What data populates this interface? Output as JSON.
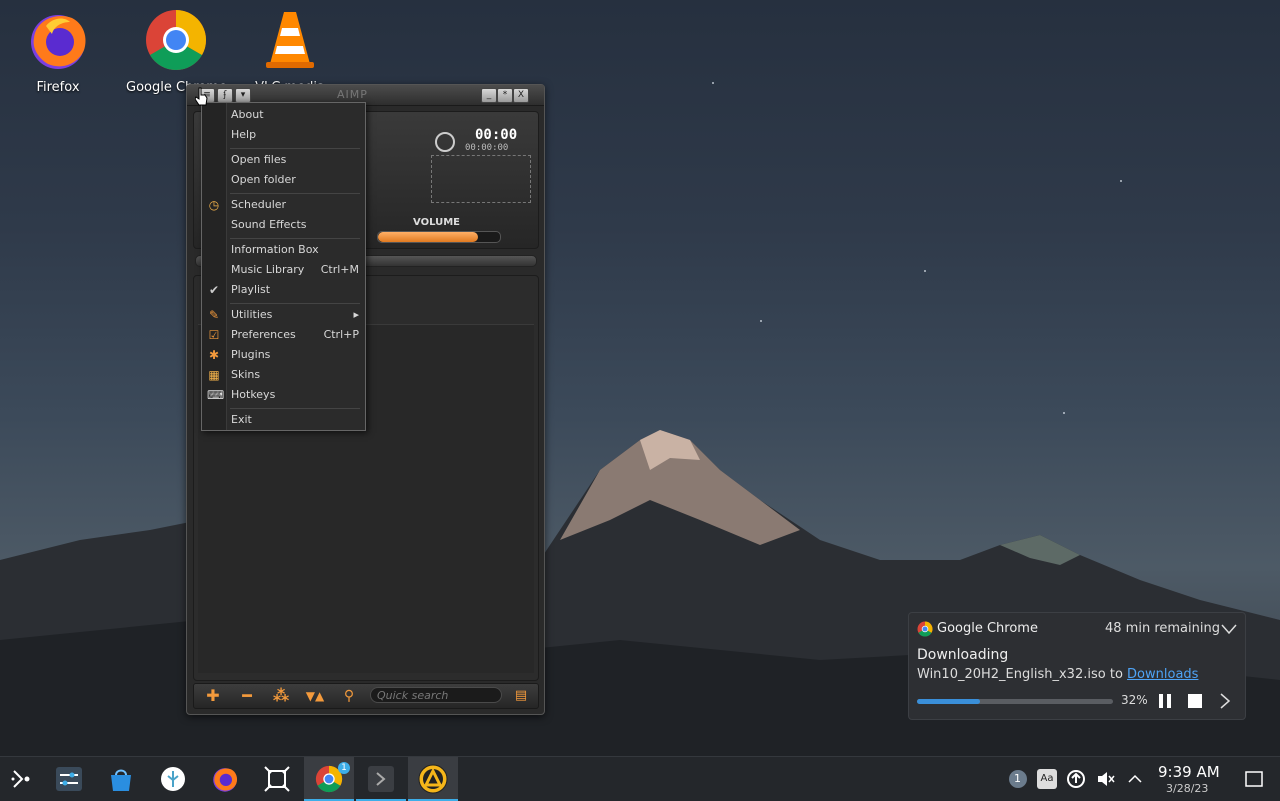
{
  "desktop_icons": [
    {
      "label": "Firefox",
      "icon": "firefox-icon"
    },
    {
      "label": "Google Chrome",
      "icon": "chrome-icon"
    },
    {
      "label": "VLC media",
      "icon": "vlc-icon"
    }
  ],
  "aimp": {
    "title": "AIMP",
    "window_buttons": [
      "_",
      "*",
      "X"
    ],
    "time_main": "00:00",
    "time_sub": "00:00:00",
    "volume_label": "VOLUME",
    "volume_level": 0.82,
    "quick_search_placeholder": "Quick search",
    "accent": "#f39a3c"
  },
  "menu": {
    "items": [
      {
        "label": "About",
        "shortcut": "",
        "icon": ""
      },
      {
        "label": "Help",
        "shortcut": "",
        "icon": ""
      },
      {
        "label": "Open files",
        "shortcut": "",
        "icon": ""
      },
      {
        "label": "Open folder",
        "shortcut": "",
        "icon": ""
      },
      {
        "label": "Scheduler",
        "shortcut": "",
        "icon": "clock-icon"
      },
      {
        "label": "Sound Effects",
        "shortcut": "",
        "icon": ""
      },
      {
        "label": "Information Box",
        "shortcut": "",
        "icon": ""
      },
      {
        "label": "Music Library",
        "shortcut": "Ctrl+M",
        "icon": ""
      },
      {
        "label": "Playlist",
        "shortcut": "",
        "icon": "check-icon"
      },
      {
        "label": "Utilities",
        "shortcut": "▸",
        "icon": "pencil-icon"
      },
      {
        "label": "Preferences",
        "shortcut": "Ctrl+P",
        "icon": "preferences-icon"
      },
      {
        "label": "Plugins",
        "shortcut": "",
        "icon": "plugins-icon"
      },
      {
        "label": "Skins",
        "shortcut": "",
        "icon": "skins-icon"
      },
      {
        "label": "Hotkeys",
        "shortcut": "",
        "icon": "hotkeys-icon"
      },
      {
        "label": "Exit",
        "shortcut": "",
        "icon": ""
      }
    ]
  },
  "notification": {
    "app": "Google Chrome",
    "time_remaining": "48 min remaining",
    "title": "Downloading",
    "file": "Win10_20H2_English_x32.iso",
    "to_text": "to",
    "link": "Downloads",
    "percent_text": "32%",
    "progress": 0.32,
    "accent": "#3a8fd9"
  },
  "taskbar": {
    "items": [
      "app-launcher-icon",
      "system-settings-icon",
      "discover-icon",
      "steam-deck-icon",
      "firefox-icon",
      "screenshot-icon",
      "chrome-icon",
      "konsole-icon",
      "aimp-icon"
    ],
    "chrome_badge": "1",
    "tray_badge": "1",
    "tray_keyboard": "Aa",
    "clock_time": "9:39 AM",
    "clock_date": "3/28/23"
  }
}
